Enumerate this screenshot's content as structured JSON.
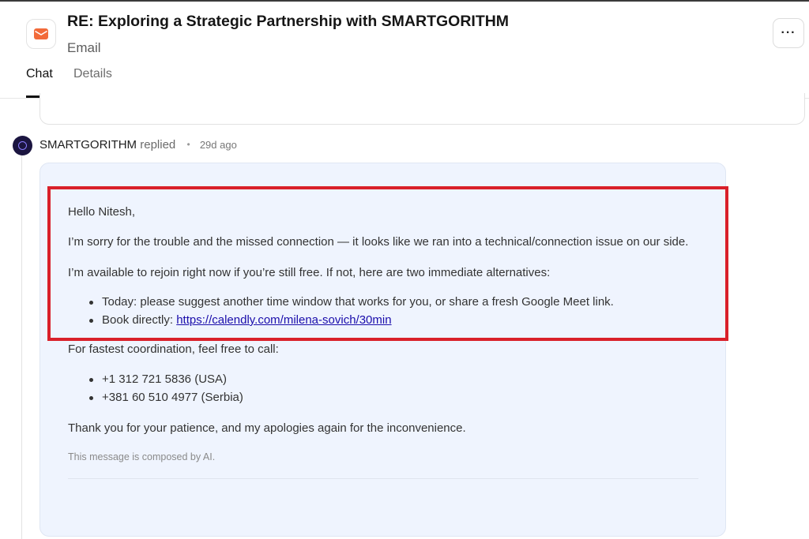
{
  "header": {
    "title": "RE: Exploring a Strategic Partnership with SMARTGORITHM",
    "subtitle": "Email",
    "app_icon": "mail-icon",
    "more_label": "···"
  },
  "tabs": [
    {
      "label": "Chat",
      "active": true
    },
    {
      "label": "Details",
      "active": false
    }
  ],
  "message": {
    "sender": "SMARTGORITHM",
    "verb": "replied",
    "separator": "•",
    "timestamp": "29d ago",
    "greeting": "Hello Nitesh,",
    "para1": "I’m sorry for the trouble and the missed connection — it looks like we ran into a technical/connection issue on our side.",
    "para2": "I’m available to rejoin right now if you’re still free. If not, here are two immediate alternatives:",
    "alternatives": [
      "Today: please suggest another time window that works for you, or share a fresh Google Meet link.",
      "Book directly: "
    ],
    "booking_link": "https://calendly.com/milena-sovich/30min",
    "call_intro": "For fastest coordination, feel free to call:",
    "phones": [
      "+1 312 721 5836 (USA)",
      "+381 60 510 4977 (Serbia)"
    ],
    "closing": "Thank you for your patience, and my apologies again for the inconvenience.",
    "ai_note": "This message is composed by AI."
  },
  "colors": {
    "highlight": "#d9202a",
    "card_bg": "#eff4fe",
    "link": "#1a0dab",
    "mail_icon": "#f26b3a"
  }
}
